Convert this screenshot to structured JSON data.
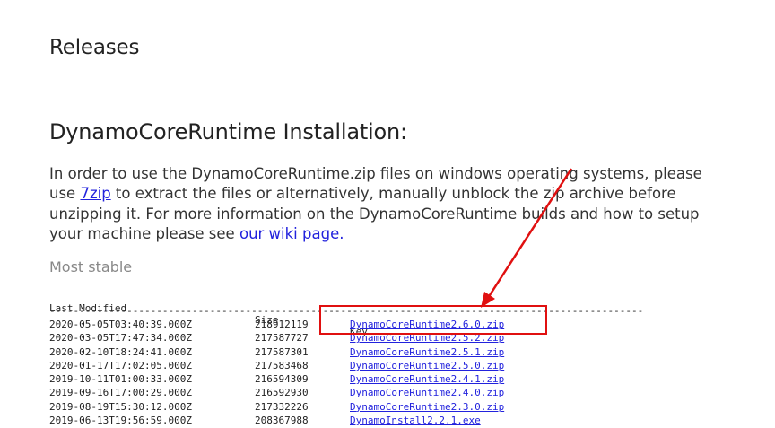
{
  "page": {
    "title": "Releases",
    "section_title": "DynamoCoreRuntime Installation:",
    "intro_part1": "In order to use the DynamoCoreRuntime.zip files on windows operating systems, please use ",
    "link_7zip": "7zip",
    "intro_part2": " to extract the files or alternatively, manually unblock the zip archive before unzipping it. For more information on the DynamoCoreRuntime builds and how to setup your machine please see ",
    "link_wiki": "our wiki page.",
    "most_stable_label": "Most stable"
  },
  "listing": {
    "headers": {
      "last_modified": "Last Modified",
      "size": "Size",
      "key": "Key"
    },
    "separator": "--------------------------------------------------------------------------------------------------------",
    "rows": [
      {
        "date": "2020-05-05T03:40:39.000Z",
        "size": "218912119",
        "key": "DynamoCoreRuntime2.6.0.zip"
      },
      {
        "date": "2020-03-05T17:47:34.000Z",
        "size": "217587727",
        "key": "DynamoCoreRuntime2.5.2.zip"
      },
      {
        "date": "2020-02-10T18:24:41.000Z",
        "size": "217587301",
        "key": "DynamoCoreRuntime2.5.1.zip"
      },
      {
        "date": "2020-01-17T17:02:05.000Z",
        "size": "217583468",
        "key": "DynamoCoreRuntime2.5.0.zip"
      },
      {
        "date": "2019-10-11T01:00:33.000Z",
        "size": "216594309",
        "key": "DynamoCoreRuntime2.4.1.zip"
      },
      {
        "date": "2019-09-16T17:00:29.000Z",
        "size": "216592930",
        "key": "DynamoCoreRuntime2.4.0.zip"
      },
      {
        "date": "2019-08-19T15:30:12.000Z",
        "size": "217332226",
        "key": "DynamoCoreRuntime2.3.0.zip"
      },
      {
        "date": "2019-06-13T19:56:59.000Z",
        "size": "208367988",
        "key": "DynamoInstall2.2.1.exe"
      }
    ]
  },
  "annotation": {
    "color": "#e01010"
  }
}
